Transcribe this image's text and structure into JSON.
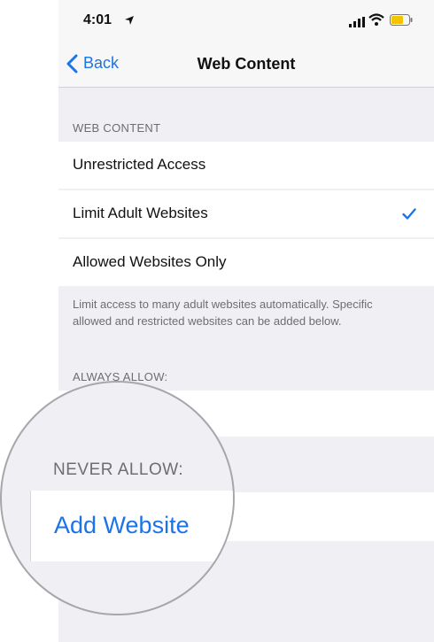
{
  "status_bar": {
    "time": "4:01",
    "accent": "#1a73e8",
    "battery_color": "#f5c400"
  },
  "nav": {
    "back_label": "Back",
    "title": "Web Content"
  },
  "web_content": {
    "header": "WEB CONTENT",
    "options": [
      {
        "label": "Unrestricted Access",
        "selected": false
      },
      {
        "label": "Limit Adult Websites",
        "selected": true
      },
      {
        "label": "Allowed Websites Only",
        "selected": false
      }
    ],
    "footer": "Limit access to many adult websites automatically. Specific allowed and restricted websites can be added below."
  },
  "always_allow": {
    "header": "ALWAYS ALLOW:"
  },
  "magnifier": {
    "never_allow_header": "NEVER ALLOW:",
    "add_website_label": "Add Website"
  },
  "icons": [
    "location-arrow-icon",
    "signal-icon",
    "wifi-icon",
    "battery-icon",
    "chevron-left-icon",
    "checkmark-icon"
  ]
}
